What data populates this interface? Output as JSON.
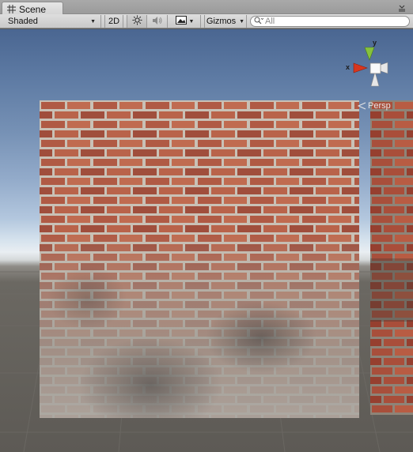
{
  "tab": {
    "title": "Scene",
    "icon": "grid-icon"
  },
  "toolbar": {
    "shading_mode": "Shaded",
    "mode_2d_label": "2D",
    "lighting_icon": "sun-icon",
    "audio_icon": "speaker-icon",
    "effects_icon": "image-icon",
    "gizmos_label": "Gizmos",
    "search_placeholder": "All"
  },
  "gizmo": {
    "x_label": "x",
    "y_label": "y",
    "projection_label": "Persp"
  },
  "colors": {
    "x_axis": "#d8361d",
    "y_axis": "#86c23c",
    "sky_top": "#4a6691",
    "horizon": "#e9eef2",
    "ground": "#5d5a55"
  }
}
